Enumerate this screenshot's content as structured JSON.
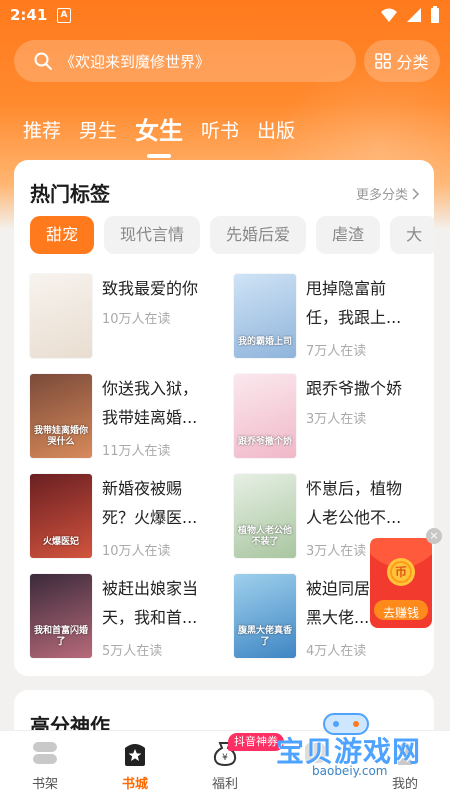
{
  "status_bar": {
    "time": "2:41",
    "notification_letter": "A"
  },
  "search": {
    "placeholder": "《欢迎来到魔修世界》"
  },
  "category_button": {
    "label": "分类"
  },
  "tabs": [
    {
      "label": "推荐",
      "active": false
    },
    {
      "label": "男生",
      "active": false
    },
    {
      "label": "女生",
      "active": true
    },
    {
      "label": "听书",
      "active": false
    },
    {
      "label": "出版",
      "active": false
    }
  ],
  "hot_tags": {
    "title": "热门标签",
    "more_label": "更多分类",
    "chips": [
      {
        "label": "甜宠",
        "active": true
      },
      {
        "label": "现代言情",
        "active": false
      },
      {
        "label": "先婚后爱",
        "active": false
      },
      {
        "label": "虐渣",
        "active": false
      },
      {
        "label": "大",
        "active": false
      }
    ],
    "books": [
      {
        "title": "致我最爱的你",
        "readers": "10万人在读",
        "cover_text": "",
        "cover_colors": [
          "#f7f3ee",
          "#e9ddd0"
        ]
      },
      {
        "title": "甩掉隐富前任，我跟上...",
        "readers": "7万人在读",
        "cover_text": "我的霸婚上司",
        "cover_colors": [
          "#cfe3f5",
          "#8fb4db"
        ]
      },
      {
        "title": "你送我入狱，我带娃离婚...",
        "readers": "11万人在读",
        "cover_text": "我带娃离婚你哭什么",
        "cover_colors": [
          "#7a4a3a",
          "#d88a5a"
        ]
      },
      {
        "title": "跟乔爷撒个娇",
        "readers": "3万人在读",
        "cover_text": "跟乔爷撒个娇",
        "cover_colors": [
          "#fbe8ee",
          "#f0b8c8"
        ]
      },
      {
        "title": "新婚夜被赐死？火爆医...",
        "readers": "10万人在读",
        "cover_text": "火爆医妃",
        "cover_colors": [
          "#6a1f22",
          "#d2543e"
        ]
      },
      {
        "title": "怀崽后，植物人老公他不...",
        "readers": "3万人在读",
        "cover_text": "植物人老公他不装了",
        "cover_colors": [
          "#e6efe4",
          "#a9c6a0"
        ]
      },
      {
        "title": "被赶出娘家当天，我和首...",
        "readers": "5万人在读",
        "cover_text": "我和首富闪婚了",
        "cover_colors": [
          "#3a2a3a",
          "#b86a7a"
        ]
      },
      {
        "title": "被迫同居，腹黑大佬...",
        "readers": "4万人在读",
        "cover_text": "腹黑大佬真香了",
        "cover_colors": [
          "#9fd0ec",
          "#3f86c4"
        ]
      }
    ]
  },
  "earn_widget": {
    "label": "去赚钱",
    "close": "×",
    "coin_char": "币"
  },
  "high_score": {
    "title": "高分神作"
  },
  "bottom_nav": [
    {
      "label": "书架",
      "icon": "bookshelf-icon",
      "active": false
    },
    {
      "label": "书城",
      "icon": "bookstore-icon",
      "active": true
    },
    {
      "label": "福利",
      "icon": "welfare-icon",
      "active": false
    },
    {
      "label": "",
      "icon": "douyin-icon",
      "active": false
    },
    {
      "label": "我的",
      "icon": "profile-icon",
      "active": false
    }
  ],
  "promo_badge": "抖音神券",
  "watermark": {
    "text": "宝贝游戏网",
    "url": "baobeiy.com"
  },
  "colors": {
    "accent": "#ff7a1c",
    "muted": "#aaaaaa"
  }
}
